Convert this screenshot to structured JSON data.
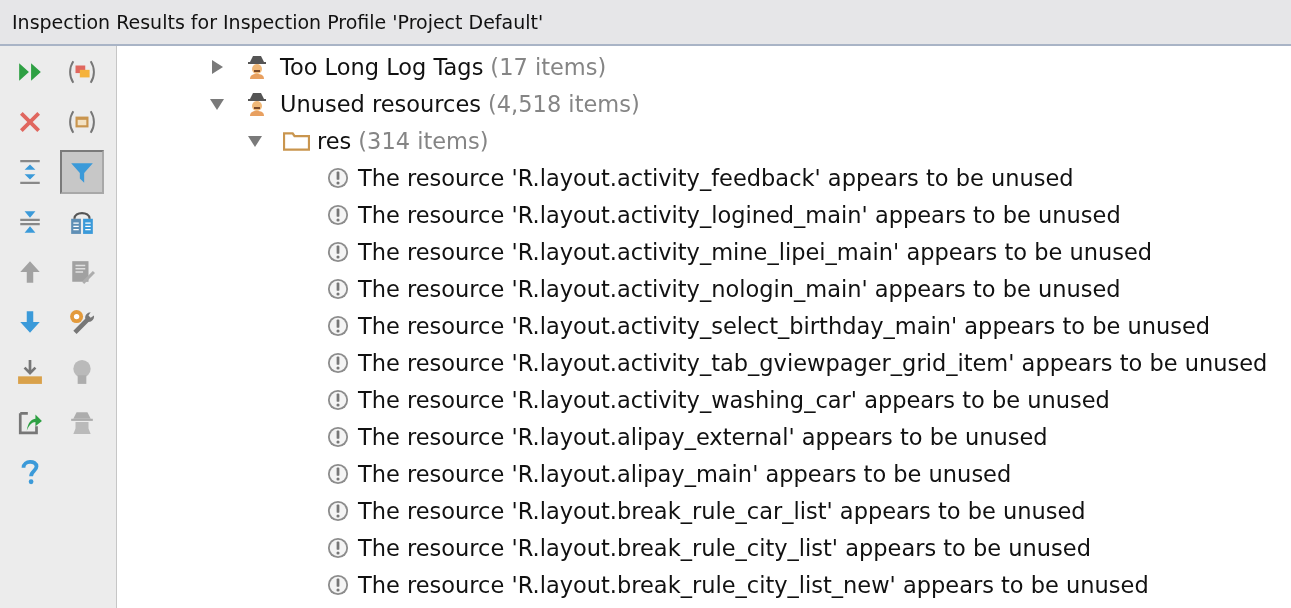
{
  "window": {
    "title": "Inspection Results for Inspection Profile 'Project Default'"
  },
  "toolbar": {
    "left": [
      {
        "kind": "rerun",
        "disabled": false
      },
      {
        "kind": "close",
        "disabled": false
      },
      {
        "kind": "expand-all",
        "disabled": false
      },
      {
        "kind": "collapse-all",
        "disabled": false
      },
      {
        "kind": "up",
        "disabled": true
      },
      {
        "kind": "down",
        "disabled": false
      },
      {
        "kind": "export",
        "disabled": false
      },
      {
        "kind": "import",
        "disabled": false
      },
      {
        "kind": "help",
        "disabled": false
      }
    ],
    "right": [
      {
        "kind": "group-severity",
        "selected": false,
        "disabled": false
      },
      {
        "kind": "group-directory",
        "selected": false,
        "disabled": false
      },
      {
        "kind": "filter",
        "selected": true,
        "disabled": false
      },
      {
        "kind": "diff",
        "selected": false,
        "disabled": false
      },
      {
        "kind": "edit",
        "selected": false,
        "disabled": true
      },
      {
        "kind": "settings",
        "selected": false,
        "disabled": false
      },
      {
        "kind": "bulb",
        "selected": false,
        "disabled": true
      },
      {
        "kind": "suppress",
        "selected": false,
        "disabled": true
      }
    ]
  },
  "tree": [
    {
      "kind": "inspection",
      "name": "Too Long Log Tags",
      "count": "(17 items)",
      "expanded": false
    },
    {
      "kind": "inspection",
      "name": "Unused resources",
      "count": "(4,518 items)",
      "expanded": true,
      "children": [
        {
          "kind": "folder",
          "name": "res",
          "count": "(314 items)",
          "expanded": true,
          "children": [
            {
              "kind": "problem",
              "name": "The resource 'R.layout.activity_feedback' appears to be unused"
            },
            {
              "kind": "problem",
              "name": "The resource 'R.layout.activity_logined_main' appears to be unused"
            },
            {
              "kind": "problem",
              "name": "The resource 'R.layout.activity_mine_lipei_main' appears to be unused"
            },
            {
              "kind": "problem",
              "name": "The resource 'R.layout.activity_nologin_main' appears to be unused"
            },
            {
              "kind": "problem",
              "name": "The resource 'R.layout.activity_select_birthday_main' appears to be unused"
            },
            {
              "kind": "problem",
              "name": "The resource 'R.layout.activity_tab_gviewpager_grid_item' appears to be unused"
            },
            {
              "kind": "problem",
              "name": "The resource 'R.layout.activity_washing_car' appears to be unused"
            },
            {
              "kind": "problem",
              "name": "The resource 'R.layout.alipay_external' appears to be unused"
            },
            {
              "kind": "problem",
              "name": "The resource 'R.layout.alipay_main' appears to be unused"
            },
            {
              "kind": "problem",
              "name": "The resource 'R.layout.break_rule_car_list' appears to be unused"
            },
            {
              "kind": "problem",
              "name": "The resource 'R.layout.break_rule_city_list' appears to be unused"
            },
            {
              "kind": "problem",
              "name": "The resource 'R.layout.break_rule_city_list_new' appears to be unused"
            }
          ]
        }
      ]
    }
  ]
}
